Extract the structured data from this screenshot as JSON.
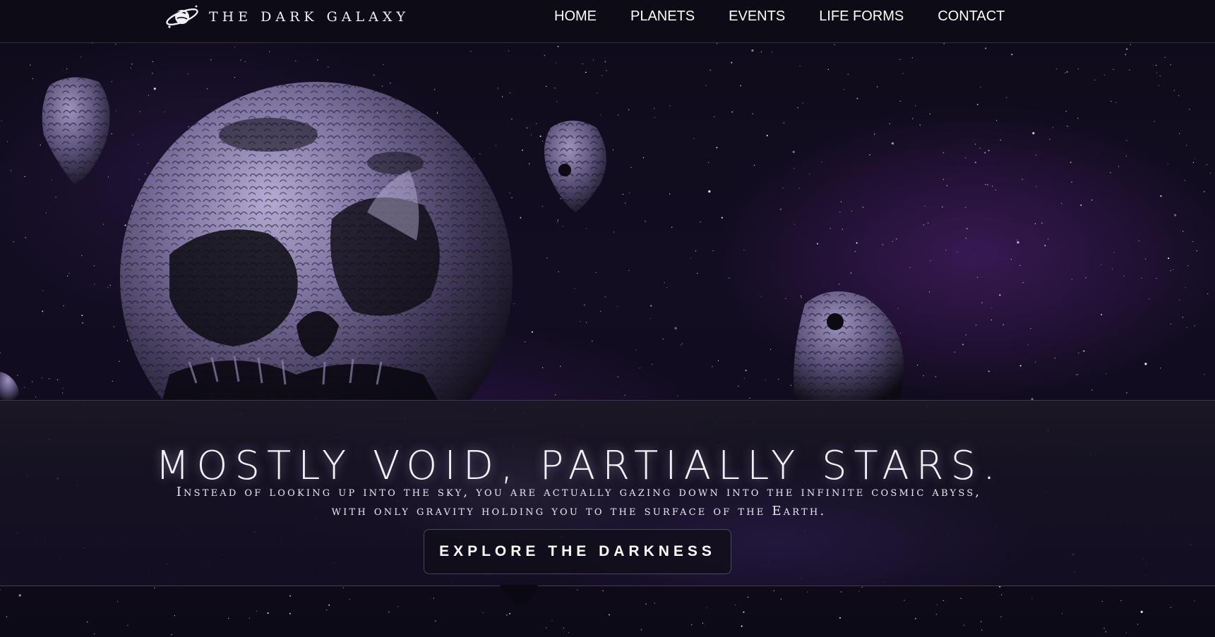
{
  "header": {
    "brand_name": "THE DARK GALAXY",
    "brand_logo_icon": "ringed-planet-icon",
    "nav": [
      {
        "label": "HOME"
      },
      {
        "label": "PLANETS"
      },
      {
        "label": "EVENTS"
      },
      {
        "label": "LIFE FORMS"
      },
      {
        "label": "CONTACT"
      }
    ]
  },
  "hero": {
    "headline": "MOSTLY VOID, PARTIALLY STARS.",
    "subtitle": "Instead of looking up into the sky, you are actually gazing down into the infinite cosmic abyss, with only gravity holding you to the surface of the Earth.",
    "cta_label": "EXPLORE THE DARKNESS"
  },
  "colors": {
    "background": "#0c0a14",
    "nebula": "#56227a",
    "text": "#f4f2f8",
    "planet_light": "#a89cc8",
    "planet_dark": "#0a0810"
  }
}
